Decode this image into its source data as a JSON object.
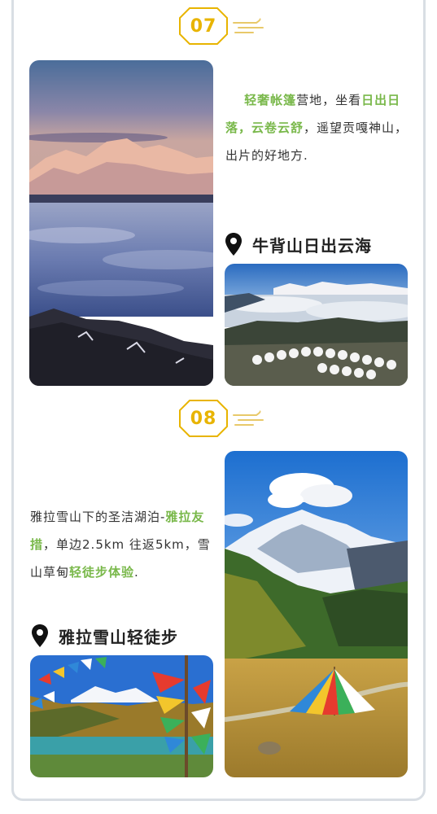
{
  "section07": {
    "number": "07",
    "desc_parts": [
      {
        "text": "轻奢帐篷",
        "hl": true
      },
      {
        "text": "营地，坐看",
        "hl": false
      },
      {
        "text": "日出日落，云卷云舒",
        "hl": true
      },
      {
        "text": "，遥望贡嘎神山，出片的好地方.",
        "hl": false
      }
    ],
    "location": "牛背山日出云海",
    "pin_icon": "location-pin-icon"
  },
  "section08": {
    "number": "08",
    "desc_parts": [
      {
        "text": "雅拉雪山下的圣洁湖泊-",
        "hl": false
      },
      {
        "text": "雅拉友措",
        "hl": true
      },
      {
        "text": "，单边2.5km 往返5km，雪山草甸",
        "hl": false
      },
      {
        "text": "轻徒步体验",
        "hl": true
      },
      {
        "text": ".",
        "hl": false
      }
    ],
    "location": "雅拉雪山轻徒步",
    "pin_icon": "location-pin-icon"
  },
  "colors": {
    "badge": "#e8b400",
    "highlight": "#79b84a",
    "frame": "#d9dee4"
  }
}
